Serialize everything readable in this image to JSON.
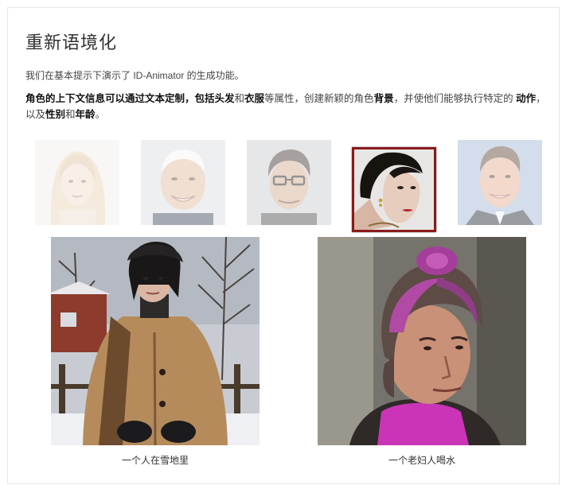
{
  "section": {
    "title": "重新语境化",
    "intro": "我们在基本提示下演示了 ID-Animator 的生成功能。",
    "desc": {
      "p1": "角色的上下文信息可以通过文本定制，包括头发",
      "p2": "和",
      "p3": "衣服",
      "p4": "等属性，创建新颖的角色",
      "p5": "背景",
      "p6": "，并使他们能够执行特定的 ",
      "p7": "动作",
      "p8": "，以及",
      "p9": "性别",
      "p10": "和",
      "p11": "年龄",
      "p12": "。"
    }
  },
  "thumbnails": [
    {
      "name": "woman-blonde",
      "selected": false
    },
    {
      "name": "older-man-smiling",
      "selected": false
    },
    {
      "name": "man-glasses",
      "selected": false
    },
    {
      "name": "woman-dark-hair",
      "selected": true
    },
    {
      "name": "man-suit",
      "selected": false
    }
  ],
  "results": [
    {
      "caption": "一个人在雪地里"
    },
    {
      "caption": "一个老妇人喝水"
    }
  ],
  "colors": {
    "selected_border": "#8b1a1a",
    "title": "#333333"
  }
}
